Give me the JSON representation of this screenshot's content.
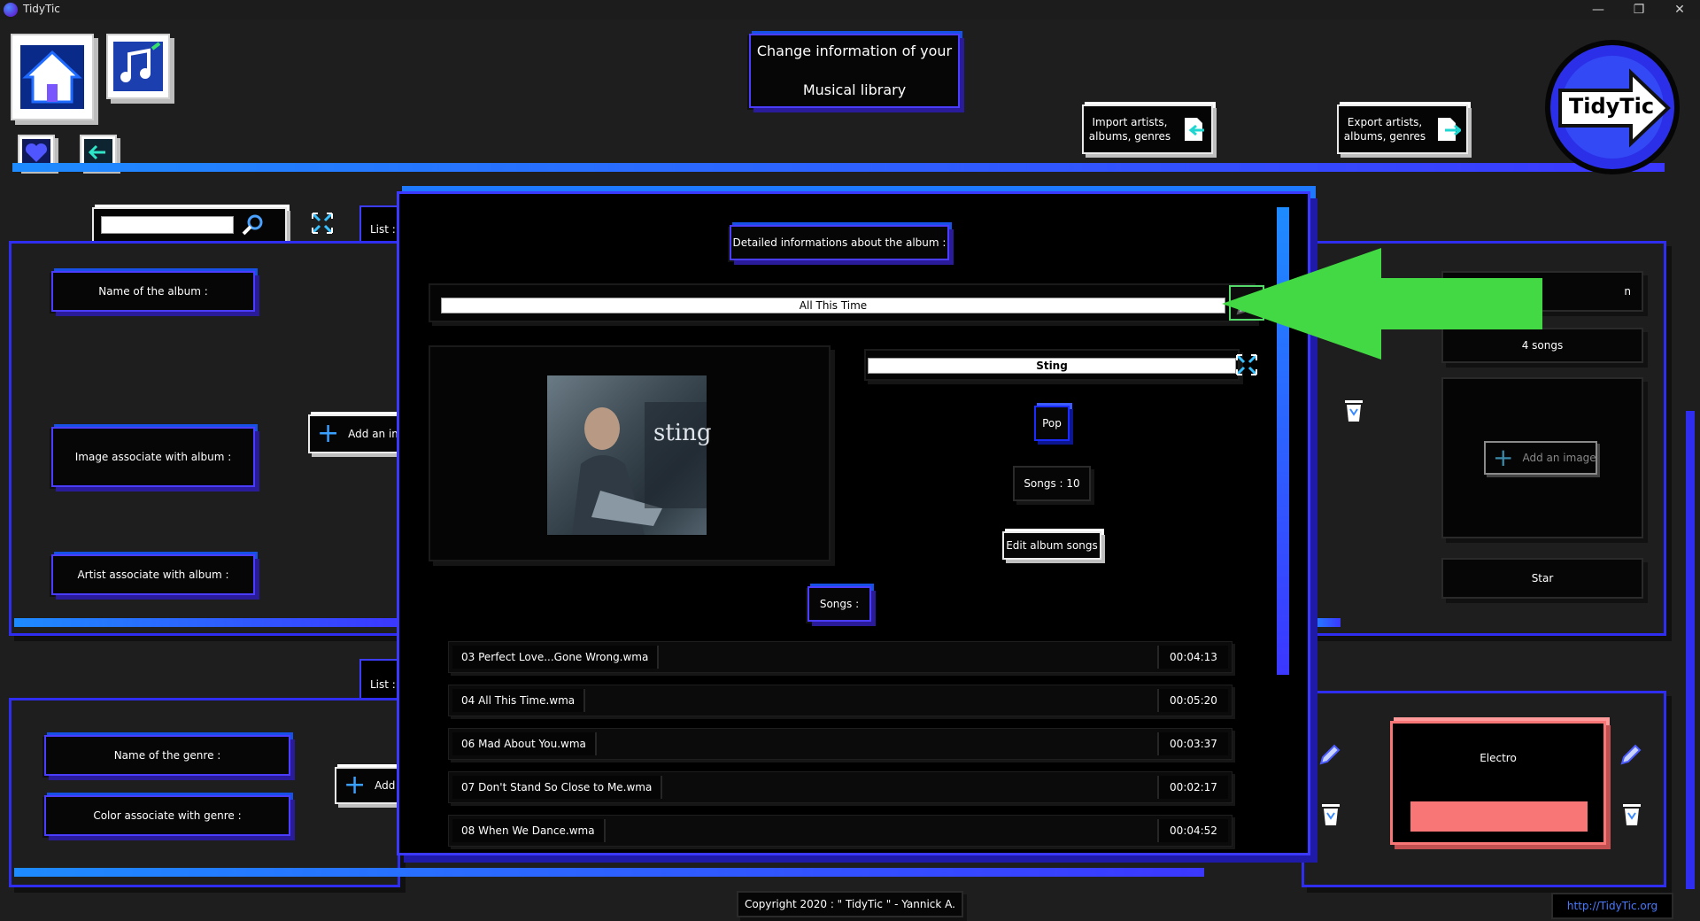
{
  "window": {
    "title": "TidyTic",
    "minimize_glyph": "—",
    "maximize_glyph": "❐",
    "close_glyph": "✕"
  },
  "header": {
    "title_line1": "Change information of your",
    "title_line2": "Musical library",
    "import_line1": "Import artists,",
    "import_line2": "albums, genres",
    "export_line1": "Export artists,",
    "export_line2": "albums, genres",
    "logo_text": "TidyTic"
  },
  "album_panel": {
    "search_value": "",
    "list_tab": "List :",
    "name_label": "Name of the album :",
    "image_label": "Image associate with album :",
    "artist_label": "Artist associate with album :",
    "add_image_label": "Add an image"
  },
  "genre_panel": {
    "list_tab": "List :",
    "name_label": "Name of the genre :",
    "color_label": "Color associate with genre :",
    "add_label": "Add"
  },
  "right_panel": {
    "title_partial": "n",
    "songs_count": "4 songs",
    "add_image_label": "Add an image",
    "artist_value": "Star"
  },
  "genre_card": {
    "name": "Electro",
    "color": "#f87676"
  },
  "modal": {
    "heading": "Detailed informations about the album :",
    "album_title": "All This Time",
    "artist": "Sting",
    "genre": "Pop",
    "songs_count_label": "Songs  : 10",
    "edit_button": "Edit album songs",
    "songs_heading": "Songs  :",
    "cover_text": "sting",
    "songs": [
      {
        "name": "03 Perfect Love...Gone Wrong.wma",
        "duration": "00:04:13"
      },
      {
        "name": "04 All This Time.wma",
        "duration": "00:05:20"
      },
      {
        "name": "06 Mad About You.wma",
        "duration": "00:03:37"
      },
      {
        "name": "07 Don't Stand So Close to Me.wma",
        "duration": "00:02:17"
      },
      {
        "name": "08 When We Dance.wma",
        "duration": "00:04:52"
      }
    ]
  },
  "footer": {
    "copyright": "Copyright 2020 : \" TidyTic \" - Yannick A.",
    "link": "http://TidyTic.org"
  },
  "colors": {
    "accent_blue": "#2f2ef0",
    "accent_cyan": "#1e8bff",
    "arrow_green": "#43d944"
  }
}
